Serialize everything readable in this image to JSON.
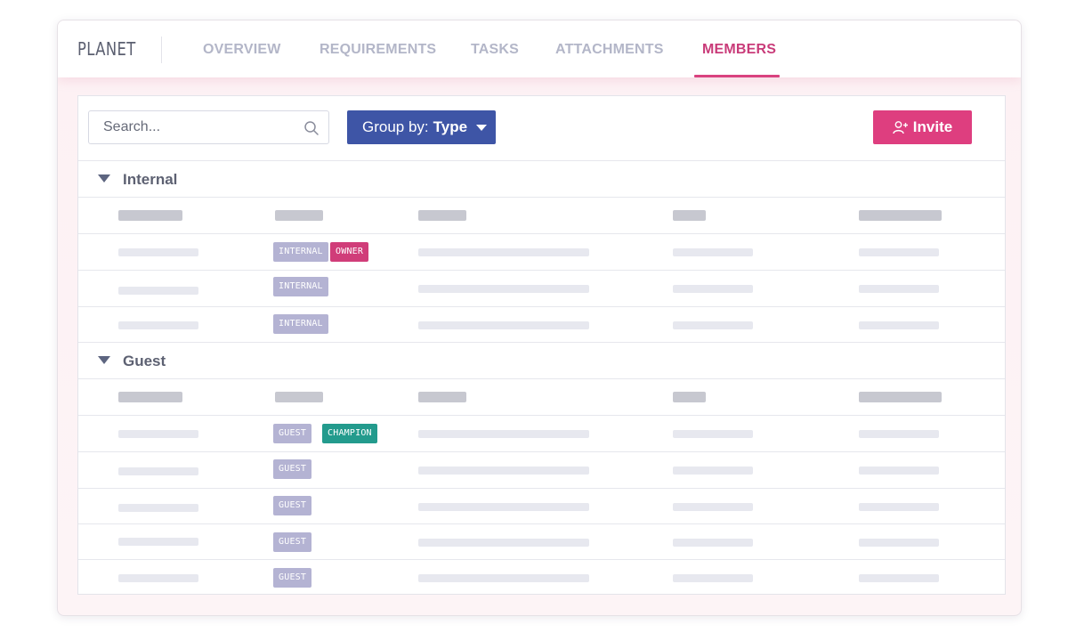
{
  "app": {
    "logo": "PLANET"
  },
  "tabs": [
    {
      "label": "OVERVIEW",
      "active": false
    },
    {
      "label": "REQUIREMENTS",
      "active": false
    },
    {
      "label": "TASKS",
      "active": false
    },
    {
      "label": "ATTACHMENTS",
      "active": false
    },
    {
      "label": "MEMBERS",
      "active": true
    }
  ],
  "toolbar": {
    "search_placeholder": "Search...",
    "groupby_prefix": "Group by:",
    "groupby_value": "Type",
    "invite_label": "Invite"
  },
  "groups": [
    {
      "title": "Internal",
      "rows": [
        {
          "badges": [
            "INTERNAL",
            "OWNER"
          ]
        },
        {
          "badges": [
            "INTERNAL"
          ]
        },
        {
          "badges": [
            "INTERNAL"
          ]
        }
      ]
    },
    {
      "title": "Guest",
      "rows": [
        {
          "badges": [
            "GUEST",
            "CHAMPION"
          ]
        },
        {
          "badges": [
            "GUEST"
          ]
        },
        {
          "badges": [
            "GUEST"
          ]
        },
        {
          "badges": [
            "GUEST"
          ]
        },
        {
          "badges": [
            "GUEST"
          ]
        }
      ]
    }
  ],
  "colors": {
    "accent": "#de3e7f",
    "primary": "#3e55a6",
    "type_badge": "#b4b3d3",
    "owner_badge": "#d03d79",
    "champion_badge": "#239b8d"
  },
  "icons": {
    "search": "search-icon",
    "invite": "user-plus-icon",
    "groupby_caret": "caret-down-icon",
    "collapse": "triangle-down-icon"
  }
}
